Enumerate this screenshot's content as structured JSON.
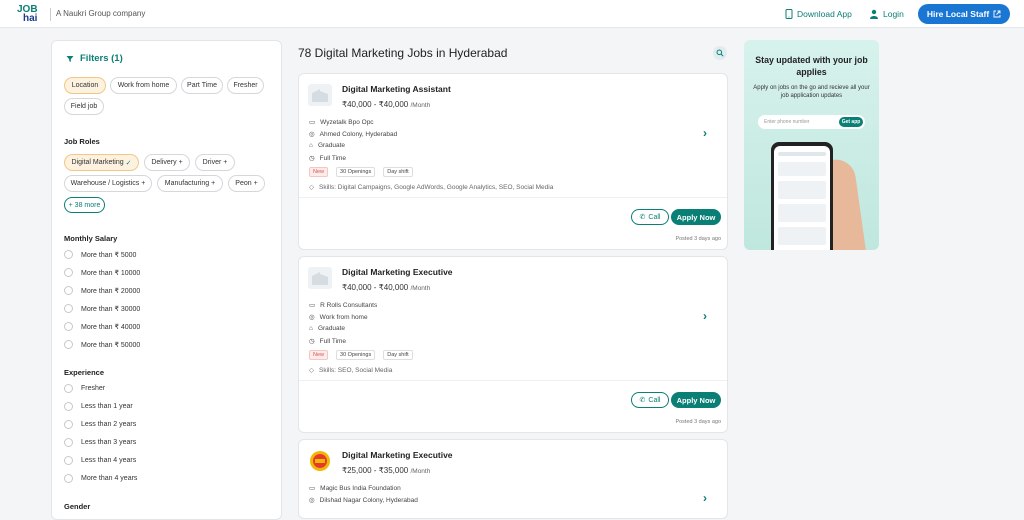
{
  "header": {
    "logo_top": "JOB",
    "logo_bottom": "hai",
    "tagline": "A Naukri Group company",
    "download_app": "Download App",
    "login": "Login",
    "hire": "Hire Local Staff"
  },
  "filters": {
    "title": "Filters (1)",
    "location_chips": [
      "Location",
      "Work from home",
      "Part Time",
      "Fresher",
      "Field job"
    ],
    "job_roles_title": "Job Roles",
    "role_chips": [
      "Digital Marketing",
      "Delivery",
      "Driver",
      "Warehouse / Logistics",
      "Manufacturing",
      "Peon"
    ],
    "more": "+ 38 more",
    "salary_title": "Monthly Salary",
    "salary_options": [
      "More than ₹ 5000",
      "More than ₹ 10000",
      "More than ₹ 20000",
      "More than ₹ 30000",
      "More than ₹ 40000",
      "More than ₹ 50000"
    ],
    "experience_title": "Experience",
    "experience_options": [
      "Fresher",
      "Less than 1 year",
      "Less than 2 years",
      "Less than 3 years",
      "Less than 4 years",
      "More than 4 years"
    ],
    "gender_title": "Gender"
  },
  "results": {
    "title": "78 Digital Marketing Jobs in Hyderabad"
  },
  "jobs": [
    {
      "title": "Digital Marketing Assistant",
      "salary": "₹40,000 - ₹40,000",
      "period": "/Month",
      "company": "Wyzetalk Bpo Opc",
      "location": "Ahmed Colony, Hyderabad",
      "education": "Graduate",
      "type": "Full Time",
      "tags": [
        "New",
        "30 Openings",
        "Day shift"
      ],
      "skills": "Skills: Digital Campaigns, Google AdWords, Google Analytics, SEO, Social Media",
      "call": "Call",
      "apply": "Apply Now",
      "posted": "Posted 3 days ago"
    },
    {
      "title": "Digital Marketing Executive",
      "salary": "₹40,000 - ₹40,000",
      "period": "/Month",
      "company": "R Rolls Consultants",
      "location": "Work from home",
      "education": "Graduate",
      "type": "Full Time",
      "tags": [
        "New",
        "30 Openings",
        "Day shift"
      ],
      "skills": "Skills: SEO, Social Media",
      "call": "Call",
      "apply": "Apply Now",
      "posted": "Posted 3 days ago"
    },
    {
      "title": "Digital Marketing Executive",
      "salary": "₹25,000 - ₹35,000",
      "period": "/Month",
      "company": "Magic Bus India Foundation",
      "location": "Dilshad Nagar Colony, Hyderabad"
    }
  ],
  "promo": {
    "headline": "Stay updated with your job applies",
    "subtext": "Apply on jobs on the go and recieve all your job application updates",
    "phone_placeholder": "Enter phone number",
    "get_app": "Get app"
  },
  "colors": {
    "brand": "#0a7f76",
    "hire_button": "#1976d2"
  }
}
